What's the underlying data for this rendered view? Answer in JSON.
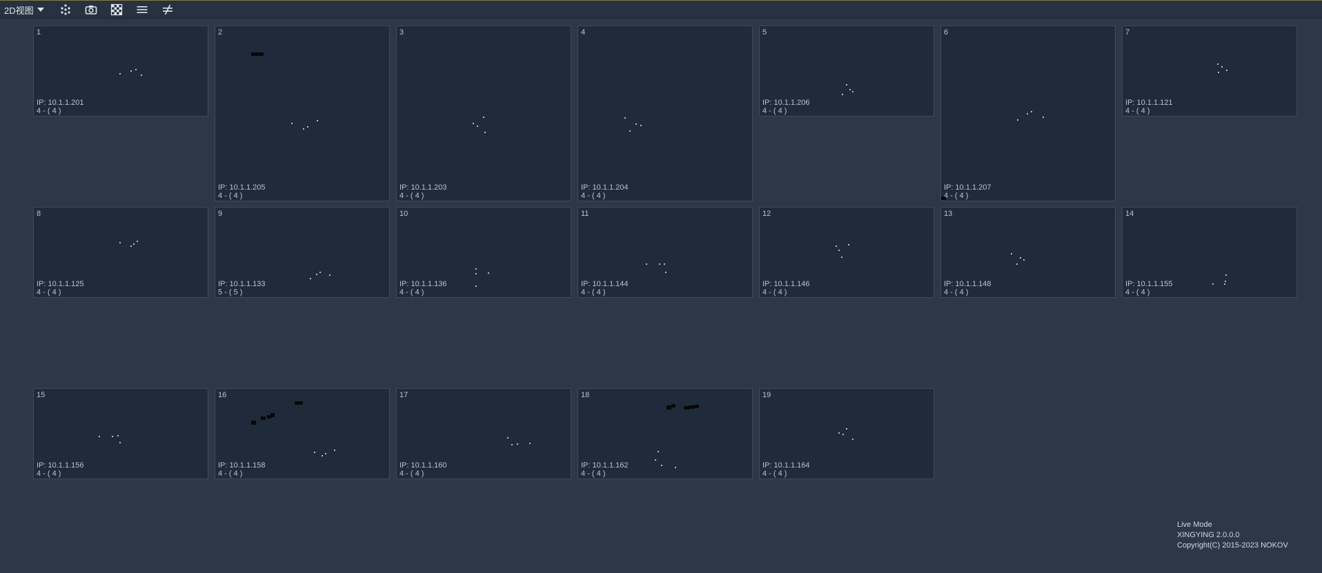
{
  "toolbar": {
    "view_label": "2D视图",
    "buttons": [
      {
        "icon": "markers-icon"
      },
      {
        "icon": "camera-icon"
      },
      {
        "icon": "checkerboard-icon"
      },
      {
        "icon": "list-icon"
      },
      {
        "icon": "not-equal-icon"
      }
    ]
  },
  "cameras": [
    {
      "id": "1",
      "ip": "IP: 10.1.1.201",
      "count": "4 - ( 4 )"
    },
    {
      "id": "2",
      "ip": "IP: 10.1.1.205",
      "count": "4 - ( 4 )"
    },
    {
      "id": "3",
      "ip": "IP: 10.1.1.203",
      "count": "4 - ( 4 )"
    },
    {
      "id": "4",
      "ip": "IP: 10.1.1.204",
      "count": "4 - ( 4 )"
    },
    {
      "id": "5",
      "ip": "IP: 10.1.1.206",
      "count": "4 - ( 4 )"
    },
    {
      "id": "6",
      "ip": "IP: 10.1.1.207",
      "count": "4 - ( 4 )"
    },
    {
      "id": "7",
      "ip": "IP: 10.1.1.121",
      "count": "4 - ( 4 )"
    },
    {
      "id": "8",
      "ip": "IP: 10.1.1.125",
      "count": "4 - ( 4 )"
    },
    {
      "id": "9",
      "ip": "IP: 10.1.1.133",
      "count": "5 - ( 5 )"
    },
    {
      "id": "10",
      "ip": "IP: 10.1.1.136",
      "count": "4 - ( 4 )"
    },
    {
      "id": "11",
      "ip": "IP: 10.1.1.144",
      "count": "4 - ( 4 )"
    },
    {
      "id": "12",
      "ip": "IP: 10.1.1.146",
      "count": "4 - ( 4 )"
    },
    {
      "id": "13",
      "ip": "IP: 10.1.1.148",
      "count": "4 - ( 4 )"
    },
    {
      "id": "14",
      "ip": "IP: 10.1.1.155",
      "count": "4 - ( 4 )"
    },
    {
      "id": "15",
      "ip": "IP: 10.1.1.156",
      "count": "4 - ( 4 )"
    },
    {
      "id": "16",
      "ip": "IP: 10.1.1.158",
      "count": "4 - ( 4 )"
    },
    {
      "id": "17",
      "ip": "IP: 10.1.1.160",
      "count": "4 - ( 4 )"
    },
    {
      "id": "18",
      "ip": "IP: 10.1.1.162",
      "count": "4 - ( 4 )"
    },
    {
      "id": "19",
      "ip": "IP: 10.1.1.164",
      "count": "4 - ( 4 )"
    }
  ],
  "footer": {
    "mode": "Live Mode",
    "version": "XINGYING 2.0.0.0",
    "copyright": "Copyright(C) 2015-2023 NOKOV"
  },
  "colors": {
    "background": "#2c3848",
    "panel": "#1f2b3a",
    "panel_border": "#3e4b5b",
    "text": "#b8c4d0",
    "marker": "#e8eef4"
  }
}
